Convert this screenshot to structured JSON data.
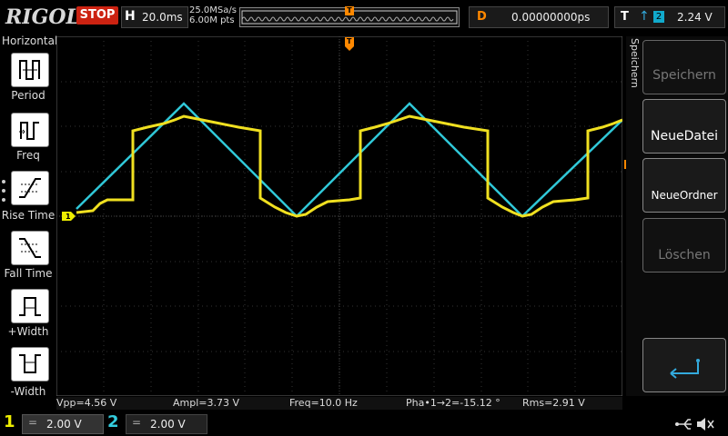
{
  "header": {
    "logo": "RIGOL",
    "run_state": "STOP",
    "timebase_label": "H",
    "timebase": "20.0ms",
    "sample_rate": "25.0MSa/s",
    "memory_depth": "6.00M pts",
    "trigger_pos_marker": "T",
    "delay_label": "D",
    "delay_value": "0.00000000ps",
    "trigger_label": "T",
    "trigger_edge": "↑",
    "trigger_source": "2",
    "trigger_level": "2.24 V"
  },
  "left_menu": {
    "title": "Horizontal",
    "items": [
      {
        "label": "Period"
      },
      {
        "label": "Freq"
      },
      {
        "label": "Rise Time"
      },
      {
        "label": "Fall Time"
      },
      {
        "label": "+Width"
      },
      {
        "label": "-Width"
      }
    ]
  },
  "right_menu": {
    "title": "Speichern",
    "buttons": [
      {
        "label": "Speichern",
        "enabled": false
      },
      {
        "label": "NeueDatei",
        "enabled": true
      },
      {
        "label": "NeueOrdner",
        "enabled": true
      },
      {
        "label": "Löschen",
        "enabled": false
      },
      {
        "label": "",
        "icon": "return-icon",
        "enabled": true
      }
    ]
  },
  "measurements": {
    "vpp": "Vpp=4.56 V",
    "ampl": "Ampl=3.73 V",
    "freq": "Freq=10.0 Hz",
    "phase": "Pha•1→2=-15.12 °",
    "rms": "Rms=2.91 V"
  },
  "channels": [
    {
      "number": "1",
      "coupling": "=",
      "scale": "2.00 V",
      "color": "#eeee00"
    },
    {
      "number": "2",
      "coupling": "=",
      "scale": "2.00 V",
      "color": "#33ccdd"
    }
  ],
  "markers": {
    "ch1_ground": "1",
    "trigger_top": "T"
  },
  "colors": {
    "ch1": "#f0e020",
    "ch2": "#30c8d8",
    "trigger": "#ff8800",
    "stop": "#cc2211"
  },
  "status_icons": [
    "usb-icon",
    "mute-icon"
  ]
}
